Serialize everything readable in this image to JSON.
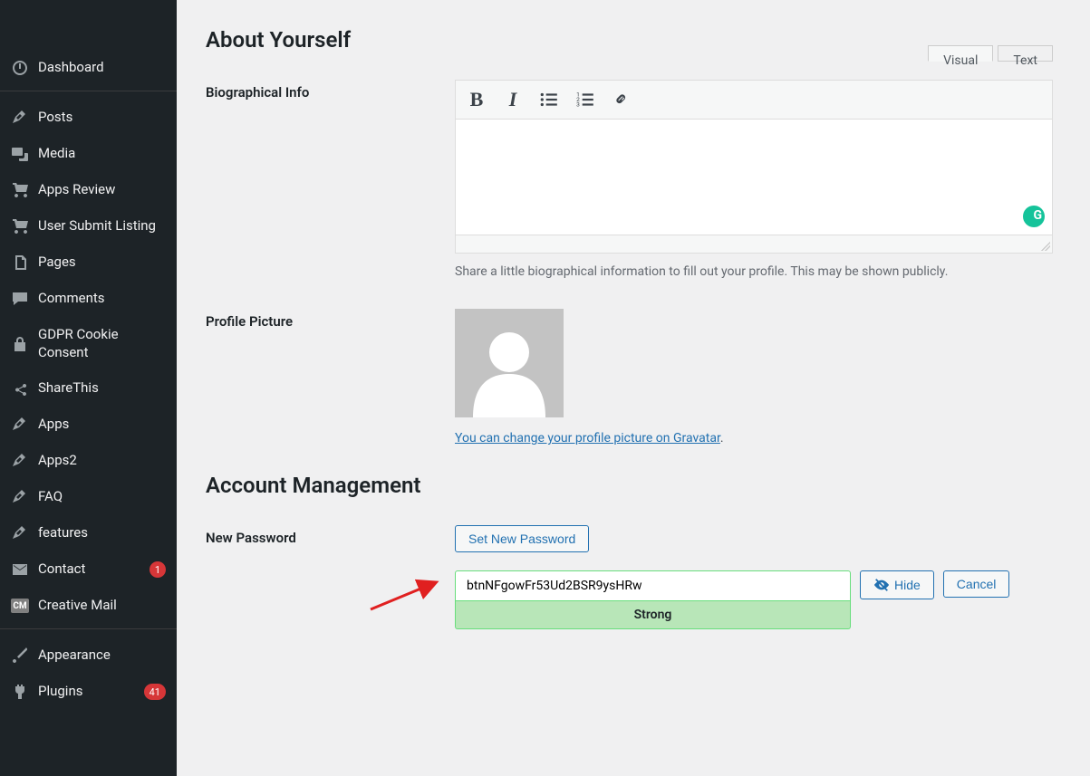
{
  "sidebar": {
    "items": [
      {
        "label": "Dashboard",
        "icon": "dashboard"
      },
      {
        "label": "Posts",
        "icon": "pin"
      },
      {
        "label": "Media",
        "icon": "media"
      },
      {
        "label": "Apps Review",
        "icon": "cart"
      },
      {
        "label": "User Submit Listing",
        "icon": "cart"
      },
      {
        "label": "Pages",
        "icon": "pages"
      },
      {
        "label": "Comments",
        "icon": "comment"
      },
      {
        "label": "GDPR Cookie Consent",
        "icon": "lock"
      },
      {
        "label": "ShareThis",
        "icon": "share"
      },
      {
        "label": "Apps",
        "icon": "pin"
      },
      {
        "label": "Apps2",
        "icon": "pin"
      },
      {
        "label": "FAQ",
        "icon": "pin"
      },
      {
        "label": "features",
        "icon": "pin"
      },
      {
        "label": "Contact",
        "icon": "mail",
        "badge": "1"
      },
      {
        "label": "Creative Mail",
        "icon": "cm"
      },
      {
        "label": "Appearance",
        "icon": "brush"
      },
      {
        "label": "Plugins",
        "icon": "plug",
        "badge": "41"
      }
    ]
  },
  "sections": {
    "about_yourself": "About Yourself",
    "account_management": "Account Management"
  },
  "bio": {
    "label": "Biographical Info",
    "tabs": {
      "visual": "Visual",
      "text": "Text"
    },
    "toolbar": {
      "bold": "B",
      "italic": "I"
    },
    "description": "Share a little biographical information to fill out your profile. This may be shown publicly."
  },
  "profile_picture": {
    "label": "Profile Picture",
    "gravatar_link": "You can change your profile picture on Gravatar",
    "gravatar_period": "."
  },
  "password": {
    "label": "New Password",
    "set_button": "Set New Password",
    "value": "btnNFgowFr53Ud2BSR9ysHRw",
    "strength": "Strong",
    "hide_button": "Hide",
    "cancel_button": "Cancel"
  }
}
